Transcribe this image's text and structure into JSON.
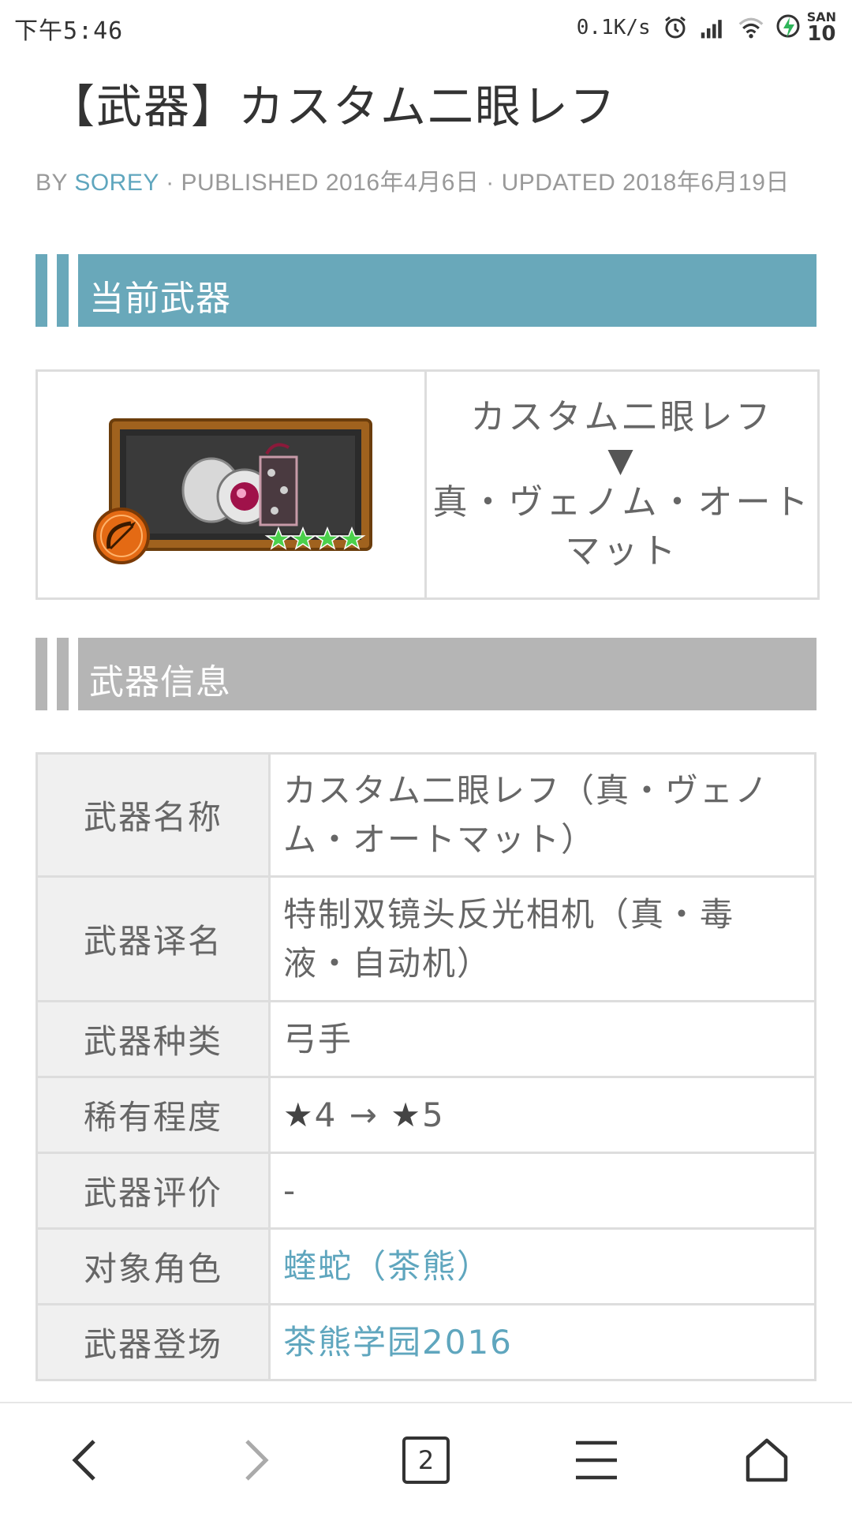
{
  "status_bar": {
    "time": "下午5:46",
    "speed": "0.1K/s",
    "battery_top": "SAN",
    "battery_bottom": "10"
  },
  "article": {
    "title": "【武器】カスタム二眼レフ",
    "meta": {
      "by": "BY ",
      "author": "SOREY",
      "published": " · PUBLISHED 2016年4月6日 · UPDATED 2018年6月19日"
    }
  },
  "sections": {
    "current_weapon": "当前武器",
    "weapon_info": "武器信息"
  },
  "weapon_box": {
    "old_name": "カスタム二眼レフ",
    "arrow": "▼",
    "new_name_line1": "真・ヴェノム・オート",
    "new_name_line2": "マット",
    "rarity_stars": 4
  },
  "info_table": [
    {
      "key": "武器名称",
      "value": "カスタム二眼レフ（真・ヴェノム・オートマット）"
    },
    {
      "key": "武器译名",
      "value": "特制双镜头反光相机（真・毒液・自动机）"
    },
    {
      "key": "武器种类",
      "value": "弓手"
    },
    {
      "key": "稀有程度",
      "value_star1": "★",
      "value_mid": "4 → ",
      "value_star2": "★",
      "value_end": "5"
    },
    {
      "key": "武器评价",
      "value": "-"
    },
    {
      "key": "对象角色",
      "value": "蝰蛇（茶熊）"
    },
    {
      "key": "武器登场",
      "value": "茶熊学园2016"
    }
  ],
  "nav": {
    "tabs_count": "2"
  },
  "colors": {
    "accent": "#69a8ba",
    "section_gray": "#b5b5b5",
    "link": "#5fa6be"
  }
}
